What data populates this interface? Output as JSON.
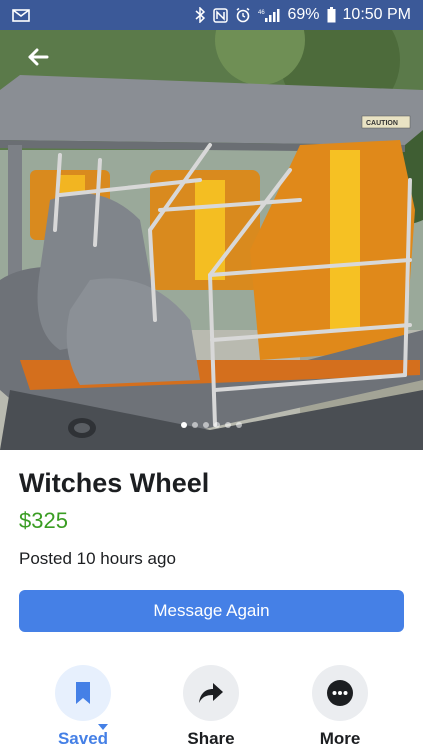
{
  "status_bar": {
    "battery": "69%",
    "time": "10:50 PM",
    "icons": [
      "envelope-icon",
      "bluetooth-icon",
      "nfc-icon",
      "alarm-icon",
      "signal-icon",
      "battery-icon"
    ]
  },
  "photo": {
    "image_count": 6,
    "active_index": 0,
    "caution_label": "CAUTION"
  },
  "listing": {
    "title": "Witches Wheel",
    "price": "$325",
    "posted": "Posted 10 hours ago",
    "message_button": "Message Again"
  },
  "actions": [
    {
      "label": "Saved",
      "icon": "bookmark-icon"
    },
    {
      "label": "Share",
      "icon": "share-arrow-icon"
    },
    {
      "label": "More",
      "icon": "more-dots-icon"
    }
  ],
  "colors": {
    "status_bar": "#3b5998",
    "accent": "#4580e6",
    "price": "#3a9d23"
  }
}
